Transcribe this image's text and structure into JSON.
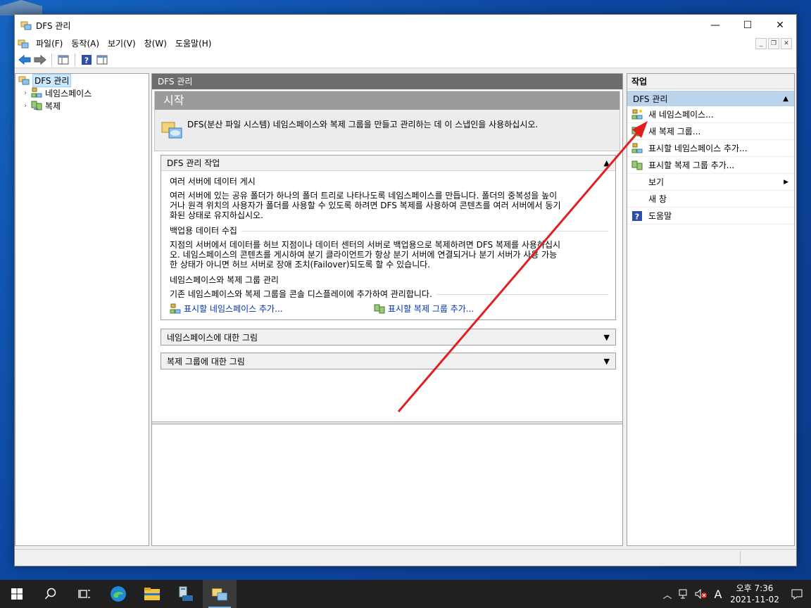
{
  "window": {
    "title": "DFS 관리"
  },
  "menu": [
    "파일(F)",
    "동작(A)",
    "보기(V)",
    "창(W)",
    "도움말(H)"
  ],
  "tree": {
    "root": "DFS 관리",
    "children": [
      "네임스페이스",
      "복제"
    ]
  },
  "center": {
    "header": "DFS 관리",
    "start_title": "시작",
    "start_text": "DFS(분산 파일 시스템) 네임스페이스와 복제 그룹을 만들고 관리하는 데 이 스냅인을 사용하십시오.",
    "tasks_title": "DFS 관리 작업",
    "sub1_title": "여러 서버에 데이터 게시",
    "sub1_text": "여러 서버에 있는 공유 폴더가 하나의 폴더 트리로 나타나도록 네임스페이스를 만듭니다. 폴더의 중복성을 높이거나 원격 위치의 사용자가 폴더를 사용할 수 있도록 하려면 DFS 복제를 사용하여 콘텐츠를 여러 서버에서 동기화된 상태로 유지하십시오.",
    "sub2_title": "백업용 데이터 수집",
    "sub2_text": "지점의 서버에서 데이터를 허브 지점이나 데이터 센터의 서버로 백업용으로 복제하려면 DFS 복제를 사용하십시오. 네임스페이스의 콘텐츠를 게시하여 분기 클라이언트가 항상 분기 서버에 연결되거나 분기 서버가 사용 가능한 상태가 아니면 허브 서버로 장애 조치(Failover)되도록 할 수 있습니다.",
    "sub3_title": "네임스페이스와 복제 그룹 관리",
    "sub3_text": "기존 네임스페이스와 복제 그룹을 콘솔 디스플레이에 추가하여 관리합니다.",
    "link1": "표시할 네임스페이스 추가...",
    "link2": "표시할 복제 그룹 추가...",
    "section2": "네임스페이스에 대한 그림",
    "section3": "복제 그룹에 대한 그림"
  },
  "actions": {
    "header": "작업",
    "group": "DFS 관리",
    "items": [
      "새 네임스페이스...",
      "새 복제 그룹...",
      "표시할 네임스페이스 추가...",
      "표시할 복제 그룹 추가...",
      "보기",
      "새 창",
      "도움말"
    ]
  },
  "taskbar": {
    "clock_time": "오후 7:36",
    "clock_date": "2021-11-02",
    "ime": "A"
  },
  "colors": {
    "annotation_arrow": "#e02020",
    "selection": "#cce8ff",
    "action_group": "#bcd3ec"
  }
}
